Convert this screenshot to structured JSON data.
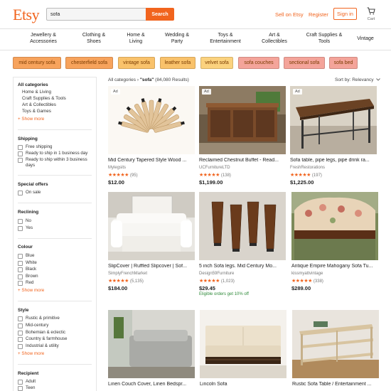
{
  "header": {
    "logo": "Etsy",
    "search": {
      "value": "sofa",
      "button": "Search"
    },
    "sell_link": "Sell on Etsy",
    "register_link": "Register",
    "signin_button": "Sign in",
    "cart_label": "Cart"
  },
  "categories": [
    "Jewellery &\nAccessories",
    "Clothing &\nShoes",
    "Home &\nLiving",
    "Wedding &\nParty",
    "Toys &\nEntertainment",
    "Art &\nCollectibles",
    "Craft Supplies &\nTools",
    "Vintage"
  ],
  "chips": [
    {
      "label": "mid century sofa",
      "color": "#F7A35C"
    },
    {
      "label": "chesterfield sofa",
      "color": "#F7A35C"
    },
    {
      "label": "vintage sofa",
      "color": "#F9C26B"
    },
    {
      "label": "leather sofa",
      "color": "#F9C26B"
    },
    {
      "label": "velvet sofa",
      "color": "#FBD27E"
    },
    {
      "label": "sofa couches",
      "color": "#F4A49A"
    },
    {
      "label": "sectional sofa",
      "color": "#F4A49A"
    },
    {
      "label": "sofa bed",
      "color": "#F4A49A"
    }
  ],
  "sidebar": {
    "all_categories": "All categories",
    "category_items": [
      "Home & Living",
      "Craft Supplies & Tools",
      "Art & Collectibles",
      "Toys & Games"
    ],
    "show_more": "+ Show more",
    "shipping_title": "Shipping",
    "shipping_options": [
      "Free shipping",
      "Ready to ship in 1 business day",
      "Ready to ship within 3 business days"
    ],
    "special_title": "Special offers",
    "special_options": [
      "On sale"
    ],
    "reclining_title": "Reclining",
    "reclining_options": [
      "No",
      "Yes"
    ],
    "colour_title": "Colour",
    "colour_options": [
      "Blue",
      "White",
      "Black",
      "Brown",
      "Red"
    ],
    "style_title": "Style",
    "style_options": [
      "Rustic & primitive",
      "Mid-century",
      "Bohemian & eclectic",
      "Country & farmhouse",
      "Industrial & utility"
    ],
    "recipient_title": "Recipient",
    "recipient_options": [
      "Adult",
      "Teen"
    ]
  },
  "results": {
    "prefix": "All categories",
    "separator": " › ",
    "query": "\"sofa\"",
    "count": "(84,080 Results)",
    "sort": "Sort by: Relevancy"
  },
  "products": [
    {
      "title": "Mid Century Tapered Style Wood ...",
      "shop": "Mylegsits",
      "rating": "★★★★★",
      "reviews": "(95)",
      "price": "$12.00",
      "ad": "Ad",
      "promo": ""
    },
    {
      "title": "Reclaimed Chestnut Buffet - Read...",
      "shop": "UCFurnitureLTD",
      "rating": "★★★★★",
      "reviews": "(138)",
      "price": "$1,199.00",
      "ad": "Ad",
      "promo": ""
    },
    {
      "title": "Sofa table, pipe legs, pipe drink ra...",
      "shop": "FreshRestorations",
      "rating": "★★★★★",
      "reviews": "(197)",
      "price": "$1,225.00",
      "ad": "Ad",
      "promo": ""
    },
    {
      "title": "SlipCover | Ruffled Slipcover | Sof...",
      "shop": "SimplyFrenchMarket",
      "rating": "★★★★★",
      "reviews": "(5,135)",
      "price": "$184.00",
      "ad": "",
      "promo": ""
    },
    {
      "title": "5 inch Sofa legs. Mid Century Mo...",
      "shop": "Design59Furniture",
      "rating": "★★★★★",
      "reviews": "(1,023)",
      "price": "$29.45",
      "ad": "",
      "promo": "Eligible orders get 10% off"
    },
    {
      "title": "Antique Empire Mahogany Sofa Tu...",
      "shop": "kissmyattvintage",
      "rating": "★★★★★",
      "reviews": "(338)",
      "price": "$289.00",
      "ad": "",
      "promo": ""
    },
    {
      "title": "Linen Couch Cover, Linen Bedspr...",
      "shop": "",
      "rating": "",
      "reviews": "",
      "price": "",
      "ad": "",
      "promo": ""
    },
    {
      "title": "Lincoln Sofa",
      "shop": "",
      "rating": "",
      "reviews": "",
      "price": "",
      "ad": "",
      "promo": ""
    },
    {
      "title": "Rustic Sofa Table / Entertainment ...",
      "shop": "",
      "rating": "",
      "reviews": "",
      "price": "",
      "ad": "",
      "promo": ""
    }
  ]
}
